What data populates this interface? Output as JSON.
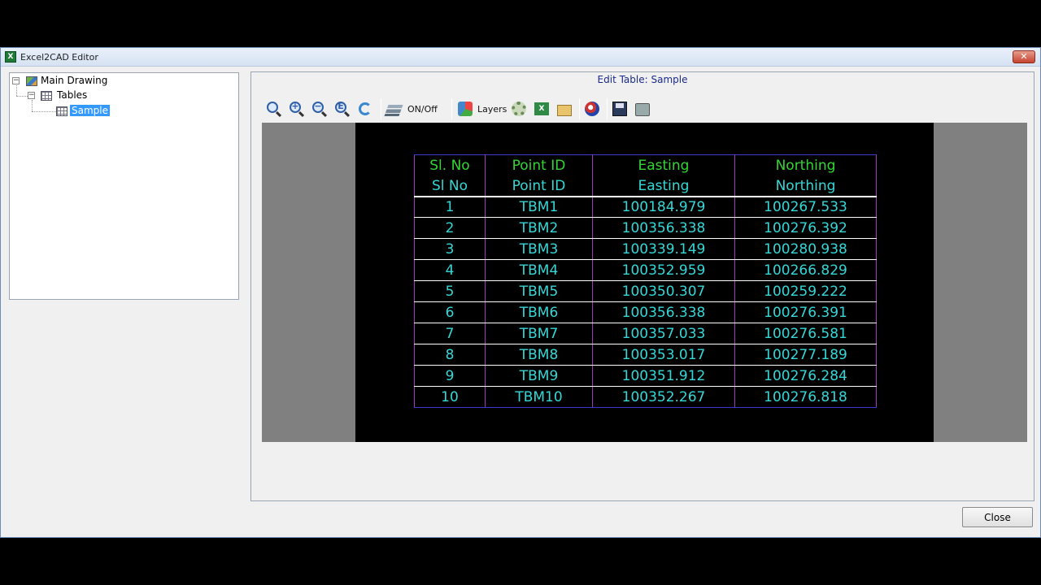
{
  "window": {
    "title": "Excel2CAD Editor",
    "app_icon_glyph": "X",
    "close_glyph": "✕"
  },
  "tree": {
    "root": "Main Drawing",
    "child": "Tables",
    "leaf": "Sample"
  },
  "editor": {
    "title": "Edit Table: Sample",
    "toolbar": {
      "onoff_label": "ON/Off",
      "layers_label": "Layers"
    }
  },
  "cad_table": {
    "header_row_1": [
      "Sl. No",
      "Point ID",
      "Easting",
      "Northing"
    ],
    "header_row_2": [
      "Sl No",
      "Point ID",
      "Easting",
      "Northing"
    ],
    "rows": [
      [
        "1",
        "TBM1",
        "100184.979",
        "100267.533"
      ],
      [
        "2",
        "TBM2",
        "100356.338",
        "100276.392"
      ],
      [
        "3",
        "TBM3",
        "100339.149",
        "100280.938"
      ],
      [
        "4",
        "TBM4",
        "100352.959",
        "100266.829"
      ],
      [
        "5",
        "TBM5",
        "100350.307",
        "100259.222"
      ],
      [
        "6",
        "TBM6",
        "100356.338",
        "100276.391"
      ],
      [
        "7",
        "TBM7",
        "100357.033",
        "100276.581"
      ],
      [
        "8",
        "TBM8",
        "100353.017",
        "100277.189"
      ],
      [
        "9",
        "TBM9",
        "100351.912",
        "100276.284"
      ],
      [
        "10",
        "TBM10",
        "100352.267",
        "100276.818"
      ]
    ],
    "colors": {
      "header_text": "#34d534",
      "body_text": "#36d7d7",
      "column_lines": "#a03ab8",
      "outer_lines": "#3a3ad0",
      "row_lines": "#ffffff"
    }
  },
  "footer": {
    "close_label": "Close"
  }
}
